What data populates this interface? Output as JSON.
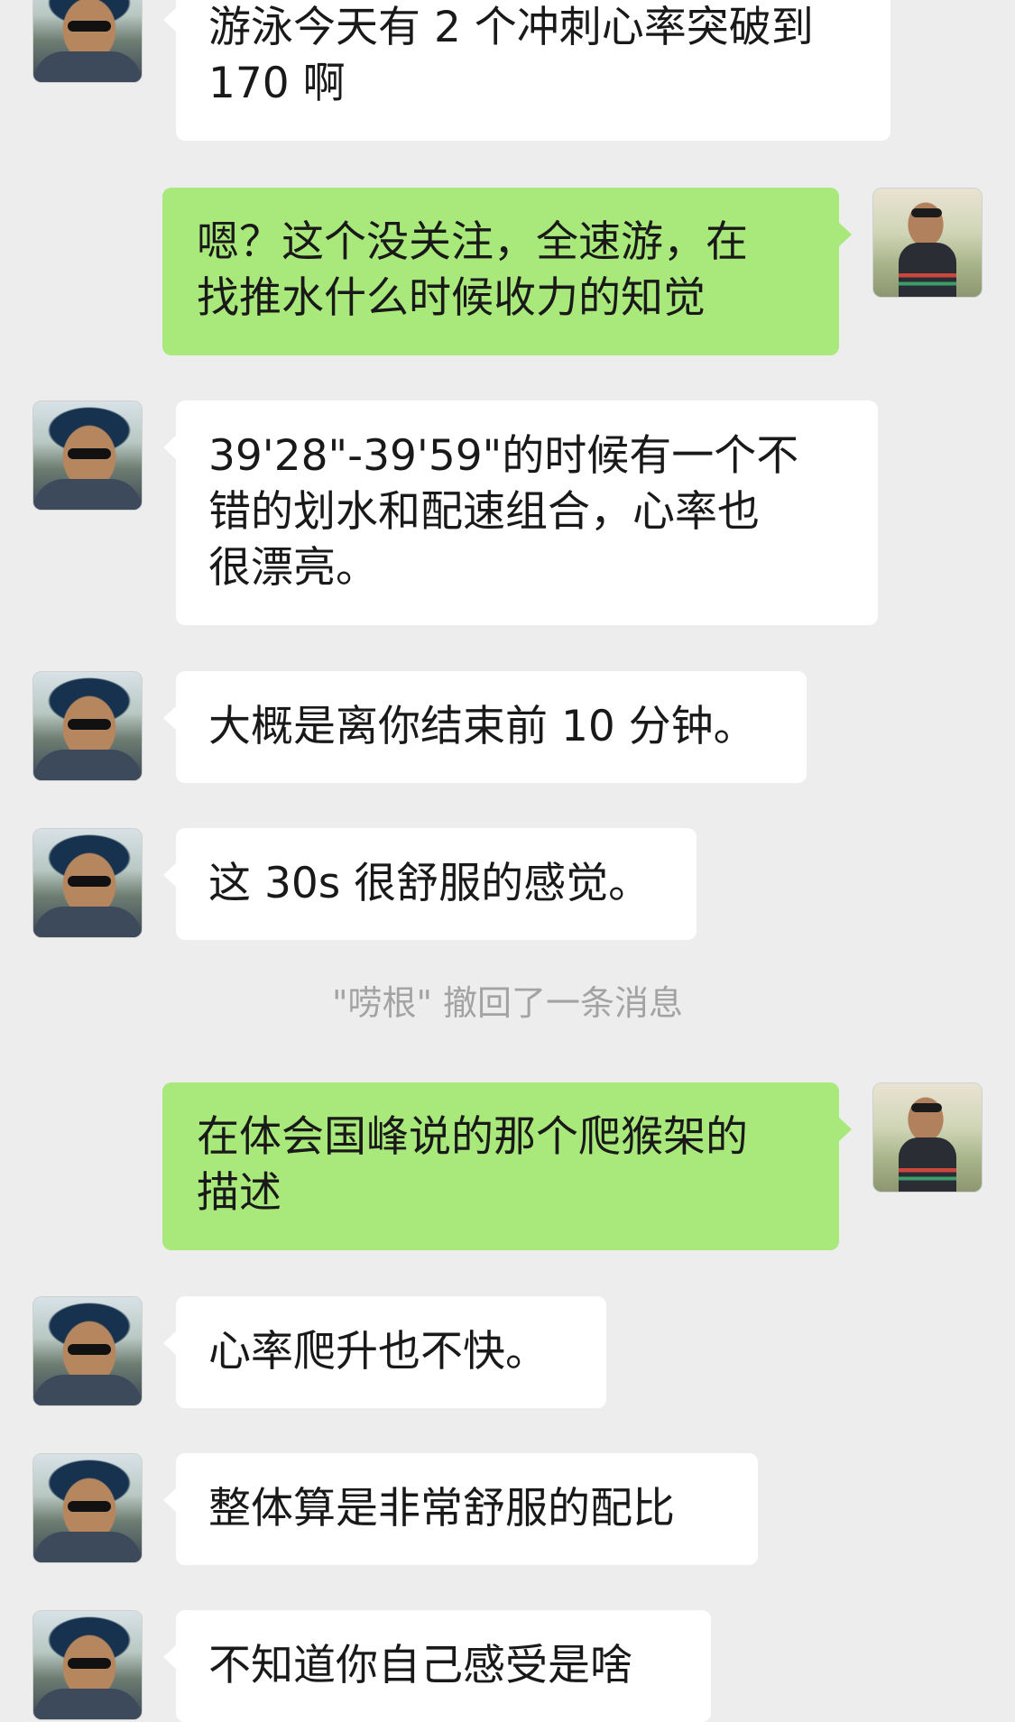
{
  "messages": [
    {
      "sender": "other",
      "text": "游泳今天有 2 个冲刺心率突破到\n170 啊"
    },
    {
      "sender": "me",
      "text": "嗯？这个没关注，全速游，在\n找推水什么时候收力的知觉"
    },
    {
      "sender": "other",
      "text": "39'28\"-39'59\"的时候有一个不\n错的划水和配速组合，心率也\n很漂亮。"
    },
    {
      "sender": "other",
      "text": "大概是离你结束前 10 分钟。"
    },
    {
      "sender": "other",
      "text": "这 30s 很舒服的感觉。"
    },
    {
      "sender": "me",
      "text": "在体会国峰说的那个爬猴架的\n描述"
    },
    {
      "sender": "other",
      "text": "心率爬升也不快。"
    },
    {
      "sender": "other",
      "text": "整体算是非常舒服的配比"
    },
    {
      "sender": "other",
      "text": "不知道你自己感受是啥"
    }
  ],
  "system_notice": "\"唠根\" 撤回了一条消息",
  "colors": {
    "background": "#ededed",
    "incoming_bubble": "#ffffff",
    "outgoing_bubble": "#a9e87b",
    "system_text": "#a3a3a3"
  }
}
